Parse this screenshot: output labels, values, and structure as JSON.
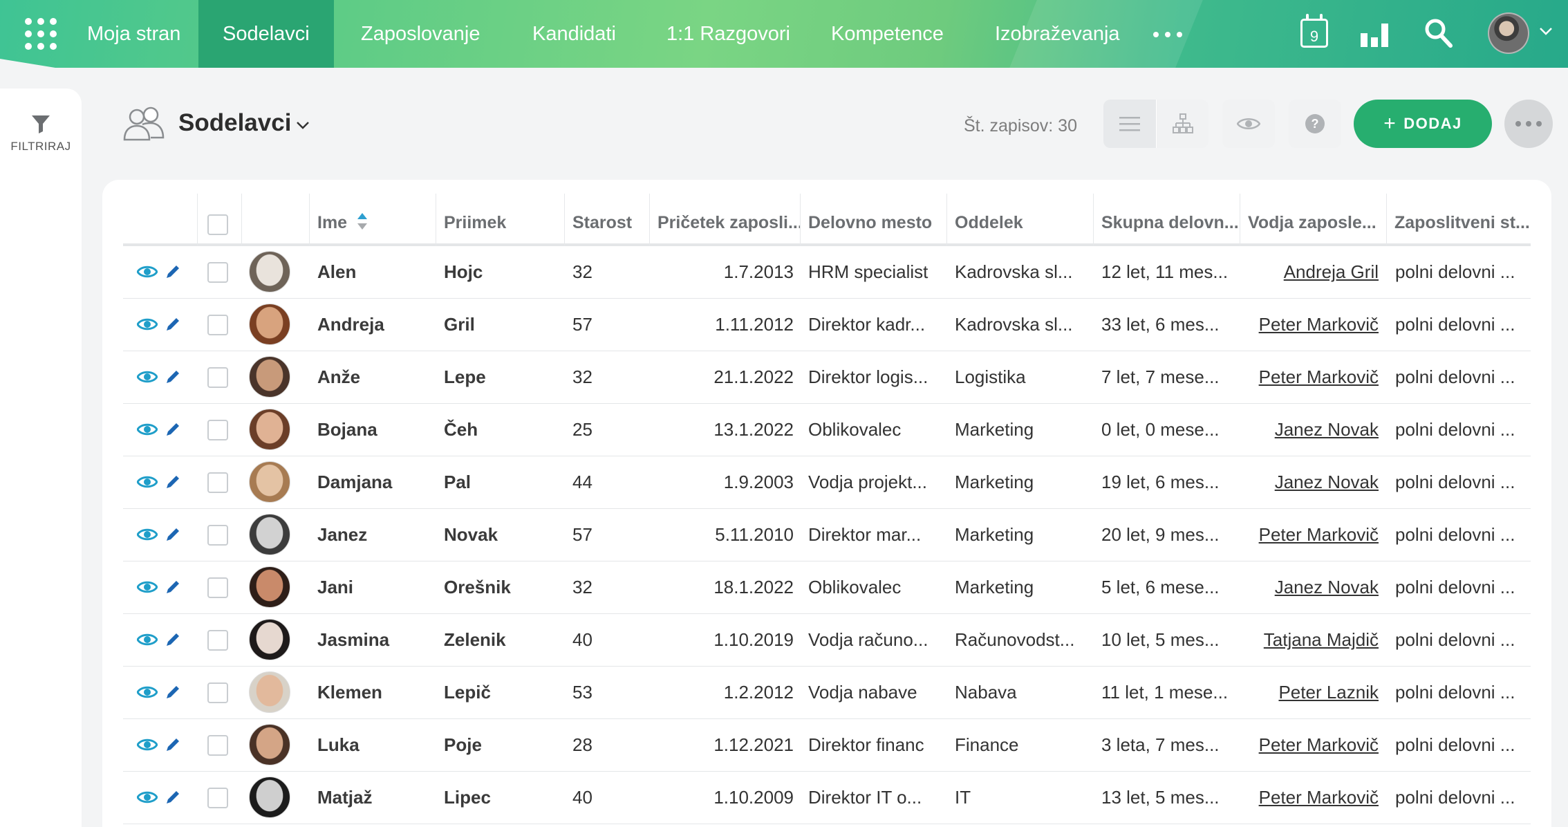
{
  "topnav": {
    "items": [
      {
        "label": "Moja stran",
        "active": false
      },
      {
        "label": "Sodelavci",
        "active": true
      },
      {
        "label": "Zaposlovanje",
        "active": false
      },
      {
        "label": "Kandidati",
        "active": false
      },
      {
        "label": "1:1 Razgovori",
        "active": false
      },
      {
        "label": "Kompetence",
        "active": false
      },
      {
        "label": "Izobraževanja",
        "active": false
      }
    ],
    "calendar_day": "9"
  },
  "sidebar": {
    "filter_label": "FILTRIRAJ"
  },
  "header": {
    "title": "Sodelavci",
    "record_count": "Št. zapisov: 30",
    "add_label": "DODAJ"
  },
  "table": {
    "columns": [
      "Ime",
      "Priimek",
      "Starost",
      "Pričetek zaposli...",
      "Delovno mesto",
      "Oddelek",
      "Skupna delovn...",
      "Vodja zaposle...",
      "Zaposlitveni st..."
    ],
    "rows": [
      {
        "ime": "Alen",
        "priimek": "Hojc",
        "starost": "32",
        "pricetek": "1.7.2013",
        "mesto": "HRM specialist",
        "oddelek": "Kadrovska sl...",
        "delovna": "12 let, 11 mes...",
        "vodja": "Andreja Gril",
        "status": "polni delovni ...",
        "photo": [
          "#e9e3dc",
          "#6e6358",
          "#3a3330"
        ]
      },
      {
        "ime": "Andreja",
        "priimek": "Gril",
        "starost": "57",
        "pricetek": "1.11.2012",
        "mesto": "Direktor kadr...",
        "oddelek": "Kadrovska sl...",
        "delovna": "33 let, 6 mes...",
        "vodja": "Peter Markovič",
        "status": "polni delovni ...",
        "photo": [
          "#d8a37e",
          "#7a3f22",
          "#c25b4b"
        ]
      },
      {
        "ime": "Anže",
        "priimek": "Lepe",
        "starost": "32",
        "pricetek": "21.1.2022",
        "mesto": "Direktor logis...",
        "oddelek": "Logistika",
        "delovna": "7 let, 7 mese...",
        "vodja": "Peter Markovič",
        "status": "polni delovni ...",
        "photo": [
          "#c89a7a",
          "#4a342a",
          "#6d5a4e"
        ]
      },
      {
        "ime": "Bojana",
        "priimek": "Čeh",
        "starost": "25",
        "pricetek": "13.1.2022",
        "mesto": "Oblikovalec",
        "oddelek": "Marketing",
        "delovna": "0 let, 0 mese...",
        "vodja": "Janez Novak",
        "status": "polni delovni ...",
        "photo": [
          "#e0b294",
          "#6b3e28",
          "#8b5a3c"
        ]
      },
      {
        "ime": "Damjana",
        "priimek": "Pal",
        "starost": "44",
        "pricetek": "1.9.2003",
        "mesto": "Vodja projekt...",
        "oddelek": "Marketing",
        "delovna": "19 let, 6 mes...",
        "vodja": "Janez Novak",
        "status": "polni delovni ...",
        "photo": [
          "#e4c3a4",
          "#a77b52",
          "#8a6a4a"
        ]
      },
      {
        "ime": "Janez",
        "priimek": "Novak",
        "starost": "57",
        "pricetek": "5.11.2010",
        "mesto": "Direktor mar...",
        "oddelek": "Marketing",
        "delovna": "20 let, 9 mes...",
        "vodja": "Peter Markovič",
        "status": "polni delovni ...",
        "photo": [
          "#d2d2d2",
          "#3c3c3c",
          "#f0f0f0"
        ]
      },
      {
        "ime": "Jani",
        "priimek": "Orešnik",
        "starost": "32",
        "pricetek": "18.1.2022",
        "mesto": "Oblikovalec",
        "oddelek": "Marketing",
        "delovna": "5 let, 6 mese...",
        "vodja": "Janez Novak",
        "status": "polni delovni ...",
        "photo": [
          "#c98a6a",
          "#2e1e18",
          "#a8322a"
        ]
      },
      {
        "ime": "Jasmina",
        "priimek": "Zelenik",
        "starost": "40",
        "pricetek": "1.10.2019",
        "mesto": "Vodja računo...",
        "oddelek": "Računovodst...",
        "delovna": "10 let, 5 mes...",
        "vodja": "Tatjana Majdič",
        "status": "polni delovni ...",
        "photo": [
          "#e6d8d0",
          "#1e1a1a",
          "#f4f4f4"
        ]
      },
      {
        "ime": "Klemen",
        "priimek": "Lepič",
        "starost": "53",
        "pricetek": "1.2.2012",
        "mesto": "Vodja nabave",
        "oddelek": "Nabava",
        "delovna": "11 let, 1 mese...",
        "vodja": "Peter Laznik",
        "status": "polni delovni ...",
        "photo": [
          "#e2b99c",
          "#d8d2c8",
          "#6b5a4e"
        ]
      },
      {
        "ime": "Luka",
        "priimek": "Poje",
        "starost": "28",
        "pricetek": "1.12.2021",
        "mesto": "Direktor financ",
        "oddelek": "Finance",
        "delovna": "3 leta, 7 mes...",
        "vodja": "Peter Markovič",
        "status": "polni delovni ...",
        "photo": [
          "#d4a586",
          "#4a3226",
          "#7a5644"
        ]
      },
      {
        "ime": "Matjaž",
        "priimek": "Lipec",
        "starost": "40",
        "pricetek": "1.10.2009",
        "mesto": "Direktor IT o...",
        "oddelek": "IT",
        "delovna": "13 let, 5 mes...",
        "vodja": "Peter Markovič",
        "status": "polni delovni ...",
        "photo": [
          "#cfcfcf",
          "#1c1c1c",
          "#8a8a8a"
        ]
      }
    ]
  },
  "colors": {
    "accent_green": "#27ae6f",
    "active_tab": "#2aa572",
    "action_icon_blue": "#1f9ec9",
    "action_icon_pencil": "#1c66b3"
  },
  "icons": [
    "apps-grid-icon",
    "more-dots-icon",
    "calendar-icon",
    "bar-chart-icon",
    "search-icon",
    "chevron-down-icon",
    "filter-icon",
    "people-icon",
    "list-view-icon",
    "org-chart-icon",
    "eye-icon",
    "help-icon",
    "plus-icon",
    "sort-icon",
    "view-icon",
    "edit-icon"
  ]
}
